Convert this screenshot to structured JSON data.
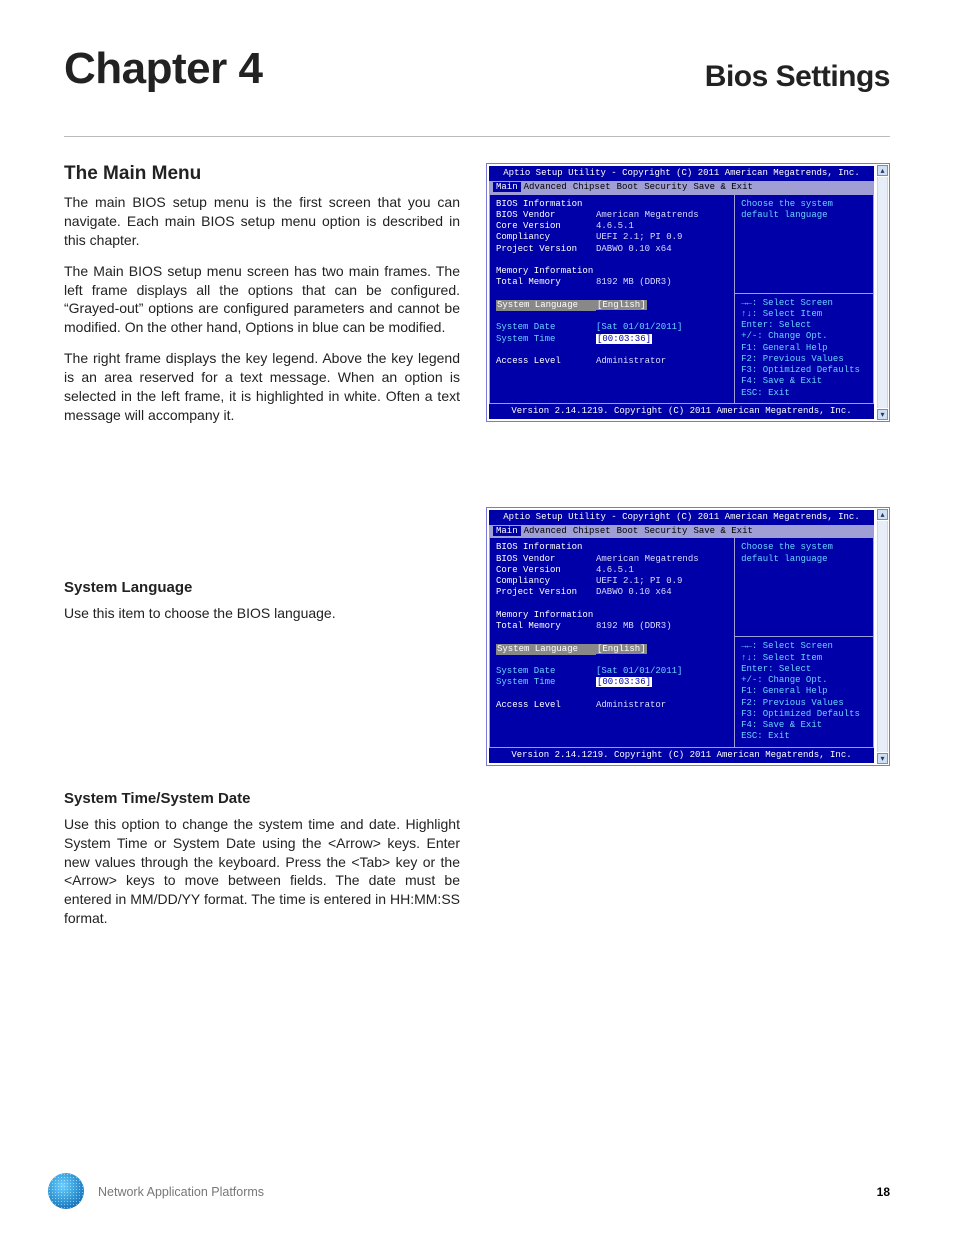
{
  "header": {
    "chapter": "Chapter 4",
    "title": "Bios Settings"
  },
  "section1": {
    "heading": "The Main Menu",
    "p1": "The main BIOS setup menu is the first screen that you can navigate. Each main BIOS setup menu option is described in this chapter.",
    "p2": "The Main BIOS setup menu screen has two main frames. The left frame displays all the options that can be configured. “Grayed-out” options are configured parameters and cannot be modified. On the other hand, Options in blue can be modified.",
    "p3": "The right frame displays the key legend. Above the key legend is an area reserved for a text message. When an option is selected in the left frame, it is highlighted in white. Often a text message will accompany it."
  },
  "section2": {
    "heading": "System Language",
    "p1": "Use this item to choose the BIOS language."
  },
  "section3": {
    "heading": "System Time/System Date",
    "p1": "Use this option to change the system time and date. Highlight System Time or System Date using the <Arrow> keys. Enter new values through the keyboard. Press the <Tab> key or the <Arrow> keys to move between fields. The date must be entered in MM/DD/YY format. The time is entered in HH:MM:SS format."
  },
  "bios": {
    "title": "Aptio Setup Utility - Copyright (C) 2011 American Megatrends, Inc.",
    "tabs": [
      "Main",
      "Advanced",
      "Chipset",
      "Boot",
      "Security",
      "Save & Exit"
    ],
    "groups": {
      "biosinfo": "BIOS Information",
      "meminfo": "Memory Information"
    },
    "fields": {
      "vendor": {
        "l": "BIOS Vendor",
        "v": "American Megatrends"
      },
      "core": {
        "l": "Core Version",
        "v": "4.6.5.1"
      },
      "compliancy": {
        "l": "Compliancy",
        "v": "UEFI 2.1; PI 0.9"
      },
      "project": {
        "l": "Project Version",
        "v": "DABWO 0.10 x64"
      },
      "totalmem": {
        "l": "Total Memory",
        "v": "8192 MB (DDR3)"
      },
      "syslang": {
        "l": "System Language",
        "v": "[English]"
      },
      "sysdate": {
        "l": "System Date",
        "v": "[Sat 01/01/2011]"
      },
      "systime": {
        "l": "System Time",
        "v": "[00:03:36]"
      },
      "access": {
        "l": "Access Level",
        "v": "Administrator"
      }
    },
    "help": {
      "l1": "Choose the system",
      "l2": "default language"
    },
    "legend": [
      "→←: Select Screen",
      "↑↓: Select Item",
      "Enter: Select",
      "+/-: Change Opt.",
      "F1: General Help",
      "F2: Previous Values",
      "F3: Optimized Defaults",
      "F4: Save & Exit",
      "ESC: Exit"
    ],
    "footer": "Version 2.14.1219. Copyright (C) 2011 American Megatrends, Inc."
  },
  "footer": {
    "text": "Network Application Platforms",
    "page": "18"
  }
}
